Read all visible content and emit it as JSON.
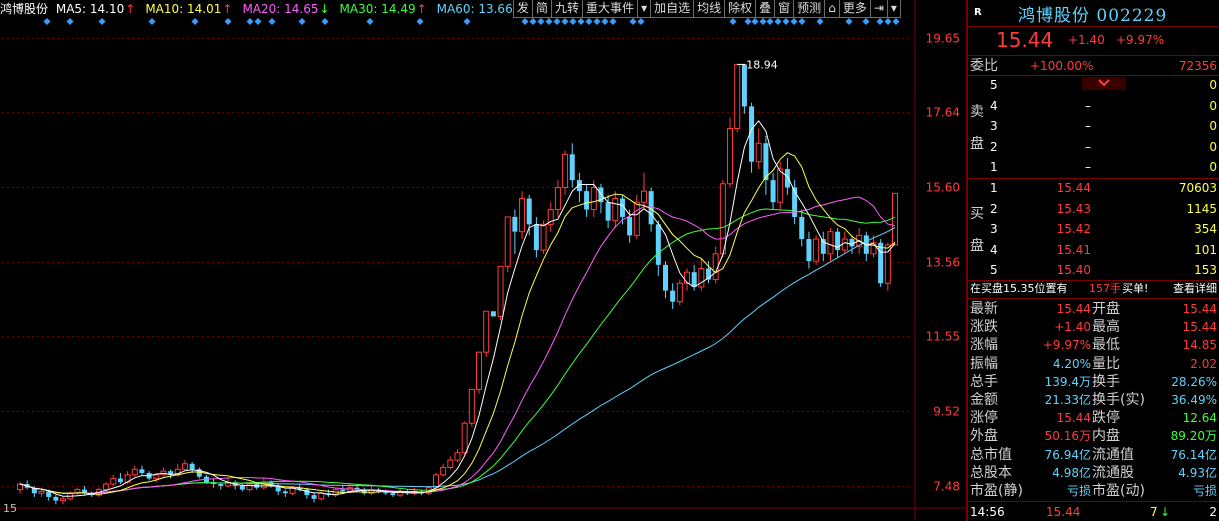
{
  "stock_label": "鸿博股份",
  "ma": [
    {
      "label": "MA5: 14.10",
      "color": "#ffffff",
      "arrow": "↑",
      "arrow_color": "#ff3b3b"
    },
    {
      "label": "MA10: 14.01",
      "color": "#ffff4c",
      "arrow": "↑",
      "arrow_color": "#ff3b3b"
    },
    {
      "label": "MA20: 14.65",
      "color": "#ff5cff",
      "arrow": "↓",
      "arrow_color": "#3cff3c"
    },
    {
      "label": "MA30: 14.49",
      "color": "#3cff3c",
      "arrow": "↑",
      "arrow_color": "#ff3b3b"
    },
    {
      "label": "MA60: 13.66",
      "color": "#5fd3ff",
      "arrow": "↑",
      "arrow_color": "#ff3b3b"
    }
  ],
  "toolbar": [
    "发",
    "简",
    "九转",
    "重大事件",
    "▾",
    "加自选",
    "均线",
    "除权",
    "叠",
    "窗",
    "预测",
    "⌂",
    "更多",
    "⇥",
    "▾"
  ],
  "price_axis": [
    "19.65",
    "17.64",
    "15.60",
    "13.56",
    "11.55",
    "9.52",
    "7.48"
  ],
  "max_label": "18.94",
  "period_label": "15",
  "colors": {
    "up": "#ff3b3b",
    "down": "#5fd3ff",
    "grid": "#7a0000",
    "ma5": "#ffffff",
    "ma10": "#ffff4c",
    "ma20": "#ff5cff",
    "ma30": "#3cff3c",
    "ma60": "#5fd3ff"
  },
  "chart_data": {
    "type": "candlestick",
    "ylim": [
      6.9,
      20.2
    ],
    "candles": [
      [
        7.4,
        7.55,
        7.6,
        7.3
      ],
      [
        7.55,
        7.45,
        7.65,
        7.4
      ],
      [
        7.45,
        7.3,
        7.5,
        7.2
      ],
      [
        7.3,
        7.35,
        7.4,
        7.2
      ],
      [
        7.35,
        7.2,
        7.4,
        7.1
      ],
      [
        7.2,
        7.1,
        7.25,
        7.0
      ],
      [
        7.1,
        7.15,
        7.2,
        7.0
      ],
      [
        7.15,
        7.3,
        7.35,
        7.1
      ],
      [
        7.3,
        7.4,
        7.45,
        7.25
      ],
      [
        7.4,
        7.3,
        7.5,
        7.25
      ],
      [
        7.3,
        7.25,
        7.35,
        7.2
      ],
      [
        7.25,
        7.4,
        7.45,
        7.2
      ],
      [
        7.4,
        7.55,
        7.6,
        7.35
      ],
      [
        7.55,
        7.7,
        7.8,
        7.5
      ],
      [
        7.7,
        7.6,
        7.85,
        7.55
      ],
      [
        7.6,
        7.8,
        7.9,
        7.55
      ],
      [
        7.8,
        7.95,
        8.05,
        7.75
      ],
      [
        7.95,
        7.85,
        8.05,
        7.8
      ],
      [
        7.85,
        7.7,
        7.9,
        7.65
      ],
      [
        7.7,
        7.8,
        7.85,
        7.6
      ],
      [
        7.8,
        7.9,
        8.0,
        7.75
      ],
      [
        7.9,
        7.8,
        7.95,
        7.7
      ],
      [
        7.8,
        7.95,
        8.1,
        7.75
      ],
      [
        7.95,
        8.1,
        8.2,
        7.9
      ],
      [
        8.1,
        7.95,
        8.15,
        7.85
      ],
      [
        7.95,
        7.75,
        8.0,
        7.7
      ],
      [
        7.75,
        7.6,
        7.8,
        7.55
      ],
      [
        7.6,
        7.55,
        7.7,
        7.45
      ],
      [
        7.55,
        7.5,
        7.6,
        7.4
      ],
      [
        7.5,
        7.6,
        7.7,
        7.45
      ],
      [
        7.6,
        7.5,
        7.65,
        7.4
      ],
      [
        7.5,
        7.4,
        7.55,
        7.35
      ],
      [
        7.4,
        7.55,
        7.6,
        7.35
      ],
      [
        7.55,
        7.45,
        7.6,
        7.4
      ],
      [
        7.45,
        7.6,
        7.7,
        7.4
      ],
      [
        7.6,
        7.5,
        7.65,
        7.45
      ],
      [
        7.5,
        7.35,
        7.55,
        7.25
      ],
      [
        7.35,
        7.3,
        7.4,
        7.2
      ],
      [
        7.3,
        7.45,
        7.5,
        7.25
      ],
      [
        7.45,
        7.4,
        7.55,
        7.35
      ],
      [
        7.4,
        7.25,
        7.45,
        7.15
      ],
      [
        7.25,
        7.15,
        7.3,
        7.05
      ],
      [
        7.15,
        7.3,
        7.35,
        7.1
      ],
      [
        7.3,
        7.25,
        7.4,
        7.2
      ],
      [
        7.25,
        7.4,
        7.45,
        7.2
      ],
      [
        7.4,
        7.35,
        7.5,
        7.3
      ],
      [
        7.35,
        7.45,
        7.55,
        7.3
      ],
      [
        7.45,
        7.4,
        7.5,
        7.35
      ],
      [
        7.4,
        7.3,
        7.45,
        7.25
      ],
      [
        7.3,
        7.4,
        7.5,
        7.25
      ],
      [
        7.4,
        7.35,
        7.45,
        7.3
      ],
      [
        7.35,
        7.3,
        7.4,
        7.25
      ],
      [
        7.3,
        7.25,
        7.35,
        7.2
      ],
      [
        7.25,
        7.35,
        7.4,
        7.2
      ],
      [
        7.35,
        7.3,
        7.4,
        7.25
      ],
      [
        7.3,
        7.35,
        7.45,
        7.25
      ],
      [
        7.35,
        7.3,
        7.4,
        7.25
      ],
      [
        7.3,
        7.45,
        7.5,
        7.25
      ],
      [
        7.45,
        7.8,
        7.85,
        7.4
      ],
      [
        7.8,
        8.0,
        8.1,
        7.75
      ],
      [
        8.0,
        8.2,
        8.3,
        7.95
      ],
      [
        8.2,
        8.4,
        8.5,
        8.15
      ],
      [
        8.4,
        9.2,
        9.25,
        8.35
      ],
      [
        9.2,
        10.12,
        10.12,
        9.1
      ],
      [
        10.12,
        11.13,
        11.13,
        10.0
      ],
      [
        11.13,
        12.24,
        12.24,
        11.0
      ],
      [
        12.24,
        12.1,
        12.24,
        12.2
      ],
      [
        12.1,
        13.46,
        13.46,
        12.0
      ],
      [
        13.46,
        14.8,
        14.8,
        13.3
      ],
      [
        14.8,
        14.4,
        15.0,
        13.8
      ],
      [
        14.4,
        15.3,
        15.5,
        14.2
      ],
      [
        15.3,
        14.6,
        15.4,
        14.3
      ],
      [
        14.6,
        13.9,
        14.8,
        13.7
      ],
      [
        13.9,
        14.6,
        14.7,
        13.8
      ],
      [
        14.6,
        15.0,
        15.2,
        14.4
      ],
      [
        15.0,
        15.6,
        15.8,
        14.8
      ],
      [
        15.6,
        16.5,
        16.6,
        15.4
      ],
      [
        16.5,
        15.8,
        16.8,
        15.6
      ],
      [
        15.8,
        15.5,
        16.0,
        15.2
      ],
      [
        15.5,
        15.0,
        15.7,
        14.8
      ],
      [
        15.0,
        15.6,
        15.8,
        14.8
      ],
      [
        15.6,
        15.2,
        15.7,
        14.9
      ],
      [
        15.2,
        14.7,
        15.4,
        14.5
      ],
      [
        14.7,
        15.3,
        15.5,
        14.5
      ],
      [
        15.3,
        14.8,
        15.4,
        14.6
      ],
      [
        14.8,
        14.3,
        15.0,
        14.1
      ],
      [
        14.3,
        15.2,
        15.4,
        14.2
      ],
      [
        15.2,
        15.5,
        16.0,
        15.0
      ],
      [
        15.5,
        14.6,
        15.6,
        14.4
      ],
      [
        14.6,
        13.5,
        14.7,
        13.2
      ],
      [
        13.5,
        12.8,
        13.6,
        12.6
      ],
      [
        12.8,
        12.5,
        13.0,
        12.3
      ],
      [
        12.5,
        13.0,
        13.1,
        12.4
      ],
      [
        13.0,
        13.3,
        13.4,
        12.8
      ],
      [
        13.3,
        12.9,
        13.5,
        12.8
      ],
      [
        12.9,
        13.4,
        13.7,
        12.8
      ],
      [
        13.4,
        13.1,
        13.6,
        13.0
      ],
      [
        13.1,
        13.8,
        14.0,
        13.0
      ],
      [
        13.8,
        15.7,
        15.8,
        13.7
      ],
      [
        15.7,
        17.2,
        17.5,
        15.6
      ],
      [
        17.2,
        18.94,
        18.94,
        17.1
      ],
      [
        18.94,
        17.8,
        18.94,
        17.6
      ],
      [
        17.8,
        16.3,
        17.9,
        16.0
      ],
      [
        16.3,
        16.8,
        17.2,
        16.1
      ],
      [
        16.8,
        15.8,
        17.0,
        15.4
      ],
      [
        15.8,
        15.2,
        16.0,
        15.0
      ],
      [
        15.2,
        16.1,
        16.3,
        15.0
      ],
      [
        16.1,
        15.6,
        16.4,
        15.4
      ],
      [
        15.6,
        14.8,
        15.8,
        14.6
      ],
      [
        14.8,
        14.2,
        15.0,
        14.0
      ],
      [
        14.2,
        13.6,
        14.4,
        13.4
      ],
      [
        13.6,
        14.2,
        14.3,
        13.5
      ],
      [
        14.2,
        13.8,
        14.4,
        13.6
      ],
      [
        13.8,
        14.4,
        14.5,
        13.6
      ],
      [
        14.4,
        13.9,
        14.5,
        13.7
      ],
      [
        13.9,
        14.2,
        14.4,
        13.8
      ],
      [
        14.2,
        14.0,
        14.3,
        13.8
      ],
      [
        14.0,
        14.3,
        14.5,
        13.8
      ],
      [
        14.3,
        13.8,
        14.4,
        13.6
      ],
      [
        13.8,
        14.1,
        14.3,
        13.7
      ],
      [
        14.1,
        13.0,
        14.2,
        12.9
      ],
      [
        13.0,
        14.04,
        14.1,
        12.8
      ],
      [
        14.04,
        15.44,
        15.44,
        14.85
      ]
    ],
    "ma5_last": 14.1,
    "ma10_last": 14.01,
    "ma20_last": 14.65,
    "ma30_last": 14.49,
    "ma60_last": 13.66
  },
  "quote": {
    "marker": "R",
    "title": "鸿博股份 002229",
    "price": "15.44",
    "change": "+1.40",
    "pct": "+9.97%",
    "weibi_label": "委比",
    "weibi_pct": "+100.00%",
    "weibi_val": "72356",
    "sell_label": [
      "卖",
      "盘"
    ],
    "buy_label": [
      "买",
      "盘"
    ],
    "sells": [
      {
        "n": "5",
        "p": "–",
        "v": "0"
      },
      {
        "n": "4",
        "p": "–",
        "v": "0"
      },
      {
        "n": "3",
        "p": "–",
        "v": "0"
      },
      {
        "n": "2",
        "p": "–",
        "v": "0"
      },
      {
        "n": "1",
        "p": "–",
        "v": "0"
      }
    ],
    "buys": [
      {
        "n": "1",
        "p": "15.44",
        "v": "70603"
      },
      {
        "n": "2",
        "p": "15.43",
        "v": "1145"
      },
      {
        "n": "3",
        "p": "15.42",
        "v": "354"
      },
      {
        "n": "4",
        "p": "15.41",
        "v": "101"
      },
      {
        "n": "5",
        "p": "15.40",
        "v": "153"
      }
    ],
    "notice": {
      "a": "在买盘15.35位置有",
      "b": "157手",
      "c": "买单!",
      "d": "查看详细"
    },
    "stats": [
      {
        "l1": "最新",
        "v1": "15.44",
        "c1": "red",
        "l2": "开盘",
        "v2": "15.44",
        "c2": "red"
      },
      {
        "l1": "涨跌",
        "v1": "+1.40",
        "c1": "red",
        "l2": "最高",
        "v2": "15.44",
        "c2": "red"
      },
      {
        "l1": "涨幅",
        "v1": "+9.97%",
        "c1": "red",
        "l2": "最低",
        "v2": "14.85",
        "c2": "red"
      },
      {
        "l1": "振幅",
        "v1": "4.20%",
        "c1": "cyn",
        "l2": "量比",
        "v2": "2.02",
        "c2": "red"
      },
      {
        "l1": "总手",
        "v1": "139.4万",
        "c1": "cyn",
        "l2": "换手",
        "v2": "28.26%",
        "c2": "cyn"
      },
      {
        "l1": "金额",
        "v1": "21.33亿",
        "c1": "cyn",
        "l2": "换手(实)",
        "v2": "36.49%",
        "c2": "cyn"
      },
      {
        "l1": "涨停",
        "v1": "15.44",
        "c1": "red",
        "l2": "跌停",
        "v2": "12.64",
        "c2": "grn"
      },
      {
        "l1": "外盘",
        "v1": "50.16万",
        "c1": "red",
        "l2": "内盘",
        "v2": "89.20万",
        "c2": "grn"
      },
      {
        "l1": "总市值",
        "v1": "76.94亿",
        "c1": "cyn",
        "l2": "流通值",
        "v2": "76.14亿",
        "c2": "cyn"
      },
      {
        "l1": "总股本",
        "v1": "4.98亿",
        "c1": "cyn",
        "l2": "流通股",
        "v2": "4.93亿",
        "c2": "cyn"
      },
      {
        "l1": "市盈(静)",
        "v1": "亏损",
        "c1": "cyn",
        "l2": "市盈(动)",
        "v2": "亏损",
        "c2": "cyn"
      }
    ],
    "tick": {
      "time": "14:56",
      "price": "15.44",
      "vol": "7",
      "dir": "↓",
      "num": "2"
    }
  }
}
